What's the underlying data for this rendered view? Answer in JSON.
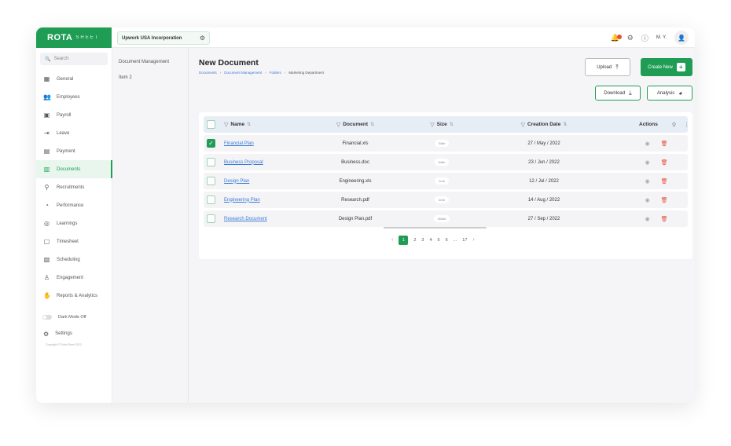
{
  "brand": {
    "name_bold": "ROTA",
    "name_light": "SHEET"
  },
  "company": {
    "name": "Upwork USA Incorporation"
  },
  "topbar": {
    "user_initials": "M. Y."
  },
  "search": {
    "placeholder": "Search"
  },
  "sidebar": {
    "items": [
      {
        "label": "General",
        "icon": "grid-icon"
      },
      {
        "label": "Employees",
        "icon": "employees-icon"
      },
      {
        "label": "Payroll",
        "icon": "payroll-icon"
      },
      {
        "label": "Leave",
        "icon": "leave-icon"
      },
      {
        "label": "Payment",
        "icon": "payment-icon"
      },
      {
        "label": "Documents",
        "icon": "documents-icon",
        "active": true
      },
      {
        "label": "Recruitments",
        "icon": "recruitments-icon"
      },
      {
        "label": "Performance",
        "icon": "performance-icon"
      },
      {
        "label": "Learnings",
        "icon": "learnings-icon"
      },
      {
        "label": "Timesheet",
        "icon": "timesheet-icon"
      },
      {
        "label": "Scheduling",
        "icon": "scheduling-icon"
      },
      {
        "label": "Engagement",
        "icon": "engagement-icon"
      },
      {
        "label": "Reports & Analytics",
        "icon": "reports-icon"
      }
    ],
    "dark_mode_label": "Dark Mode Off",
    "settings_label": "Settings",
    "copyright": "Copyright © Rota Sheet 2022"
  },
  "subsidebar": {
    "items": [
      "Document Management",
      "Item 2"
    ]
  },
  "page": {
    "title": "New Document",
    "breadcrumb": [
      "Documents",
      "Document Management",
      "Folders",
      "Marketing Department"
    ]
  },
  "buttons": {
    "upload": "Upload",
    "create_new": "Create New",
    "download": "Download",
    "analysis": "Analysis"
  },
  "table": {
    "headers": {
      "name": "Name",
      "document": "Document",
      "size": "Size",
      "date": "Creation Date",
      "actions": "Actions"
    },
    "rows": [
      {
        "name": "Financial Plan",
        "document": "Financial.xls",
        "size": "34kb",
        "date": "27 / May / 2022",
        "checked": true
      },
      {
        "name": "Business Proposal",
        "document": "Business.doc",
        "size": "54kb",
        "date": "23 / Jun / 2022",
        "checked": false
      },
      {
        "name": "Design Plan",
        "document": "Engineering.xls",
        "size": "1mb",
        "date": "12 / Jul / 2022",
        "checked": false
      },
      {
        "name": "Engineering Plan",
        "document": "Research.pdf",
        "size": "4mb",
        "date": "14 / Aug / 2022",
        "checked": false
      },
      {
        "name": "Research Document",
        "document": "Design Plan.pdf",
        "size": "264kb",
        "date": "27 / Sep / 2022",
        "checked": false
      }
    ]
  },
  "pagination": {
    "pages": [
      "1",
      "2",
      "3",
      "4",
      "5",
      "6",
      "...",
      "17"
    ],
    "current": "1"
  },
  "colors": {
    "accent": "#1f9d55",
    "link": "#3a7bd5",
    "danger": "#e74c3c",
    "header_bg": "#e7edf5"
  }
}
